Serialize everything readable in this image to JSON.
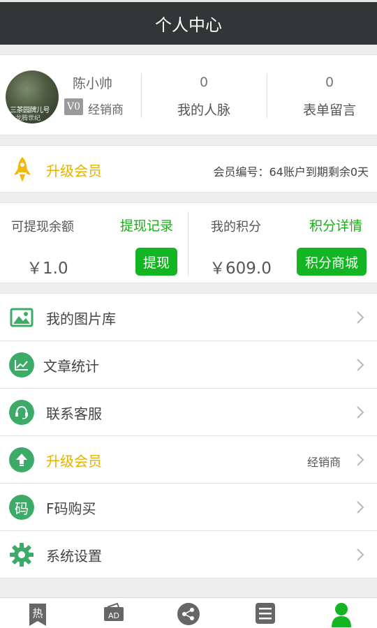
{
  "header": {
    "title": "个人中心"
  },
  "profile": {
    "avatar_caption_line1": "三茶园牌儿号",
    "avatar_caption_line2": "龙腾世纪",
    "name": "陈小帅",
    "level_badge": "V0",
    "level": "经销商",
    "contacts": {
      "count": "0",
      "label": "我的人脉"
    },
    "messages": {
      "count": "0",
      "label": "表单留言"
    }
  },
  "upgrade_banner": {
    "title": "升级会员",
    "info": "会员编号：64账户到期剩余0天",
    "icon": "rocket-icon"
  },
  "wallet": {
    "balance_label": "可提现余额",
    "balance_link": "提现记录",
    "balance_amount": "￥1.0",
    "withdraw_button": "提现",
    "points_label": "我的积分",
    "points_link": "积分详情",
    "points_amount": "￥609.0",
    "mall_button": "积分商城"
  },
  "menu": {
    "items": [
      {
        "label": "我的图片库",
        "icon": "image-gallery-icon",
        "side": ""
      },
      {
        "label": "文章统计",
        "icon": "chart-line-icon",
        "side": ""
      },
      {
        "label": "联系客服",
        "icon": "headset-icon",
        "side": ""
      },
      {
        "label": "升级会员",
        "icon": "upgrade-arrow-icon",
        "side": "经销商"
      },
      {
        "label": "F码购买",
        "icon": "code-icon",
        "icon_text": "码",
        "side": ""
      },
      {
        "label": "系统设置",
        "icon": "gear-icon",
        "side": ""
      }
    ]
  },
  "tabbar": {
    "hot_icon_text": "热",
    "ad_icon_text": "AD",
    "tabs": [
      "hot-tab",
      "ad-tab",
      "share-tab",
      "list-tab",
      "profile-tab"
    ]
  },
  "colors": {
    "header_bg": "#333637",
    "accent_green": "#13b522",
    "link_green": "#1aac19",
    "highlight_yellow": "#e5b200",
    "icon_green": "#3dab68"
  }
}
